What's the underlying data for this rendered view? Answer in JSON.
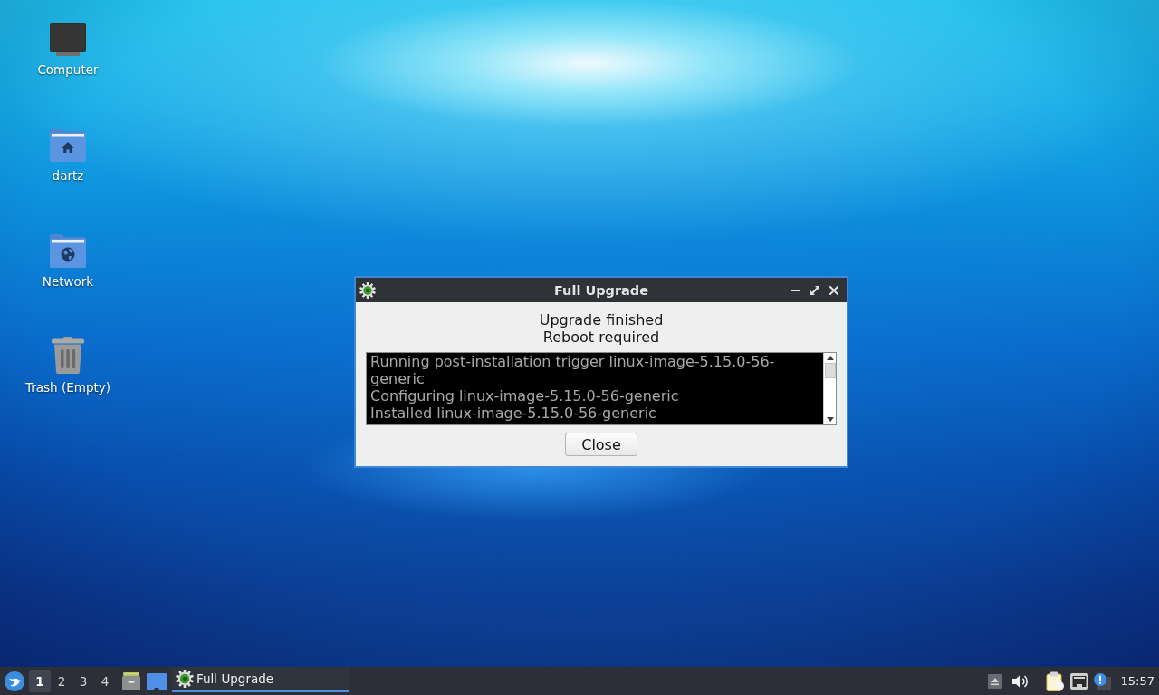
{
  "desktop_icons": [
    {
      "kind": "computer",
      "label": "Computer"
    },
    {
      "kind": "home_folder",
      "label": "dartz"
    },
    {
      "kind": "network_folder",
      "label": "Network"
    },
    {
      "kind": "trash",
      "label": "Trash (Empty)"
    }
  ],
  "dialog": {
    "title": "Full Upgrade",
    "message": [
      "Upgrade finished",
      "Reboot required"
    ],
    "log": [
      "Running post-installation trigger linux-image-5.15.0-56-generic",
      "Configuring linux-image-5.15.0-56-generic",
      "Installed linux-image-5.15.0-56-generic"
    ],
    "button": "Close"
  },
  "taskbar": {
    "workspaces": [
      {
        "label": "1",
        "selected": true
      },
      {
        "label": "2",
        "selected": false
      },
      {
        "label": "3",
        "selected": false
      },
      {
        "label": "4",
        "selected": false
      }
    ],
    "tasks": [
      {
        "title": "Full Upgrade",
        "selected": true
      }
    ],
    "clock": "15:57"
  }
}
